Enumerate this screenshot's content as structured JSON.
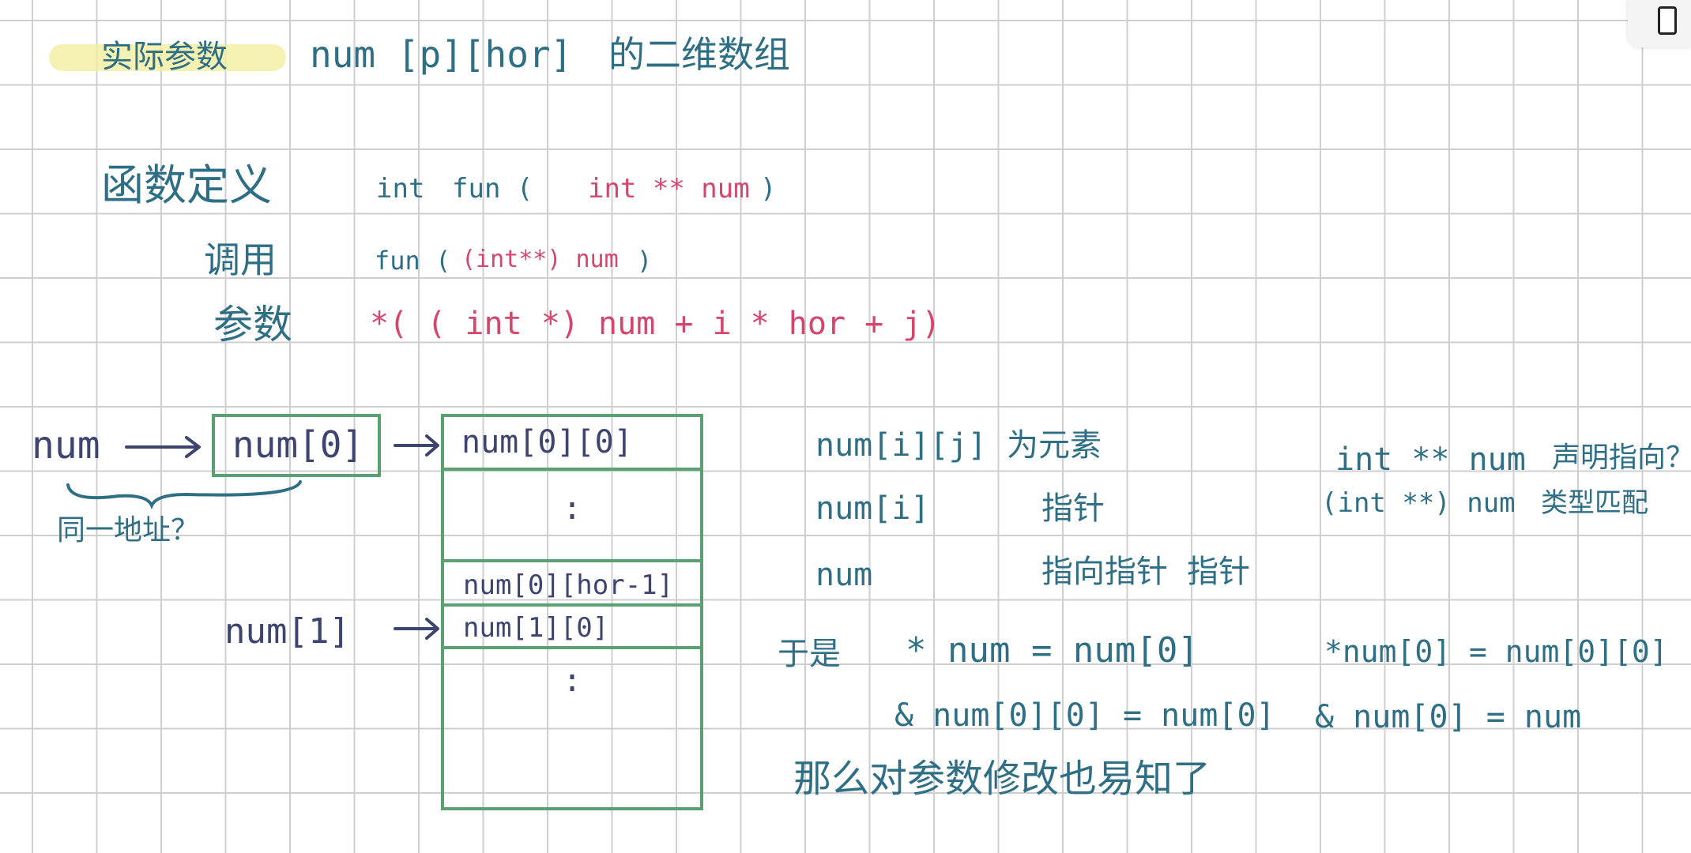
{
  "title": {
    "label": "实际参数",
    "expr": "num [p][hor]",
    "desc": "的二维数组"
  },
  "definitions": {
    "def_label": "函数定义",
    "def_code_a": "int",
    "def_code_b": "fun (",
    "def_code_param": "int ** num",
    "def_code_c": ")",
    "call_label": "调用",
    "call_code_a": "fun (",
    "call_code_cast": "(int**) num",
    "call_code_b": ")",
    "param_label": "参数",
    "param_expr": "*( ( int *) num + i * hor + j)"
  },
  "diagram": {
    "num": "num",
    "cell_num0": "num[0]",
    "same_address": "同一地址？",
    "num1": "num[1]",
    "cells": [
      "num[0][0]",
      ":",
      "num[0][hor-1]",
      "num[1][0]",
      ":"
    ]
  },
  "notes": {
    "n1_expr": "num[i][j]",
    "n1_desc": "为元素",
    "n2_expr": "num[i]",
    "n2_desc": "指针",
    "n3_expr": "num",
    "n3_desc": "指向指针 指针",
    "yu": "于是",
    "eq1": "* num = num[0]",
    "eq2": "*num[0] = num[0][0]",
    "eq3": "& num[0][0] = num[0]",
    "eq4": "& num[0] = num",
    "conclusion": "那么对参数修改也易知了",
    "side1_expr": "int ** num",
    "side1_desc": "声明指向？",
    "side2_expr": "(int **) num",
    "side2_desc": "类型匹配"
  },
  "colors": {
    "ink_blue": "#2f6f86",
    "ink_navy": "#3d4470",
    "ink_red": "#d6456b",
    "box_green": "#5aa072",
    "highlight": "#f3eda0"
  }
}
